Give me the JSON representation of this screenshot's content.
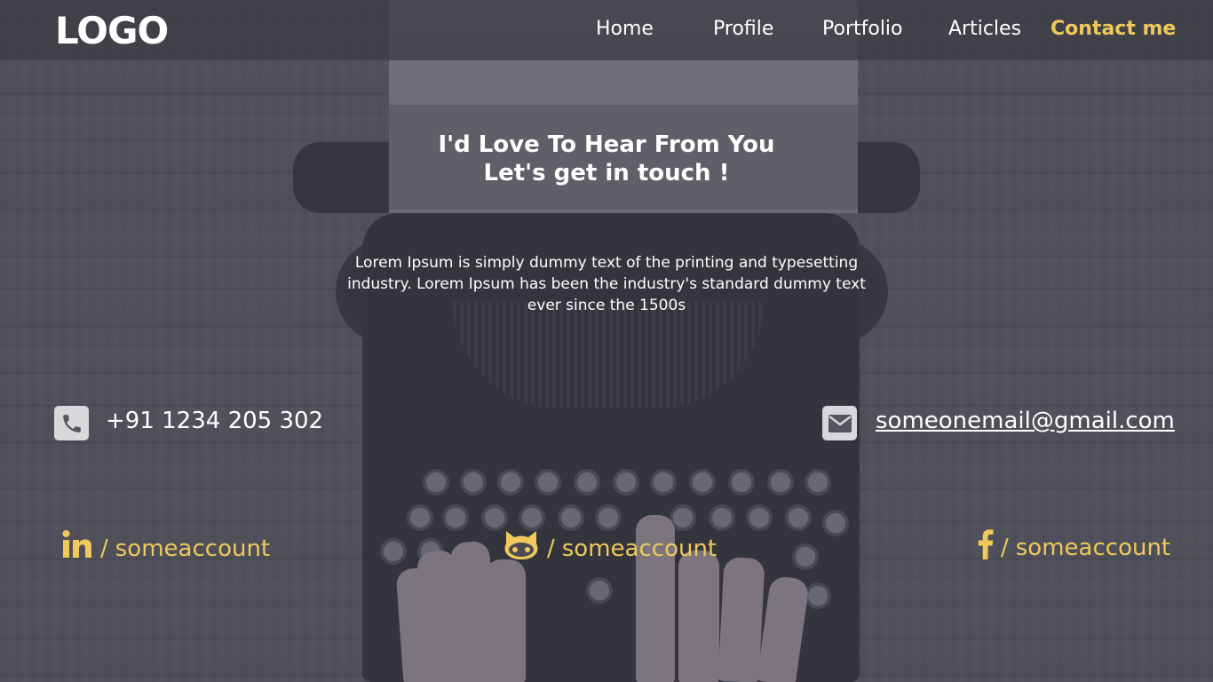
{
  "colors": {
    "accent": "#efc95a",
    "text": "#ffffff",
    "navbar_bg": "#3c3c44"
  },
  "navbar": {
    "logo": "LOGO",
    "items": [
      {
        "label": "Home",
        "active": false
      },
      {
        "label": "Profile",
        "active": false
      },
      {
        "label": "Portfolio",
        "active": false
      },
      {
        "label": "Articles",
        "active": false
      },
      {
        "label": "Contact me",
        "active": true
      }
    ]
  },
  "hero": {
    "title_line1": "I'd Love To Hear From You",
    "title_line2": "Let's get in touch !",
    "description": "Lorem Ipsum is simply dummy text of the printing and typesetting industry. Lorem Ipsum has been the industry's standard dummy text ever since the 1500s"
  },
  "contact": {
    "phone": {
      "icon": "phone-icon",
      "value": "+91 1234 205 302"
    },
    "email": {
      "icon": "mail-icon",
      "value": "someonemail@gmail.com"
    }
  },
  "social": [
    {
      "icon": "linkedin-icon",
      "separator": "/",
      "handle": "someaccount"
    },
    {
      "icon": "github-icon",
      "separator": "/",
      "handle": "someaccount"
    },
    {
      "icon": "facebook-icon",
      "separator": "/",
      "handle": "someaccount"
    }
  ]
}
